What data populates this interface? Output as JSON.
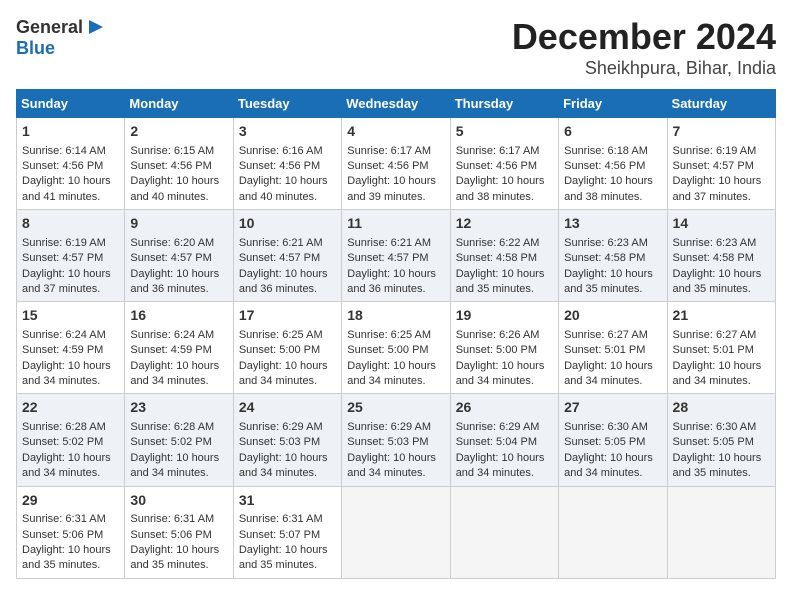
{
  "header": {
    "logo_general": "General",
    "logo_blue": "Blue",
    "title": "December 2024",
    "subtitle": "Sheikhpura, Bihar, India"
  },
  "calendar": {
    "days_of_week": [
      "Sunday",
      "Monday",
      "Tuesday",
      "Wednesday",
      "Thursday",
      "Friday",
      "Saturday"
    ],
    "weeks": [
      [
        {
          "day": "",
          "content": ""
        },
        {
          "day": "",
          "content": ""
        },
        {
          "day": "",
          "content": ""
        },
        {
          "day": "",
          "content": ""
        },
        {
          "day": "",
          "content": ""
        },
        {
          "day": "",
          "content": ""
        },
        {
          "day": "",
          "content": ""
        }
      ]
    ],
    "cells": [
      {
        "day": "1",
        "lines": [
          "Sunrise: 6:14 AM",
          "Sunset: 4:56 PM",
          "Daylight: 10 hours",
          "and 41 minutes."
        ]
      },
      {
        "day": "2",
        "lines": [
          "Sunrise: 6:15 AM",
          "Sunset: 4:56 PM",
          "Daylight: 10 hours",
          "and 40 minutes."
        ]
      },
      {
        "day": "3",
        "lines": [
          "Sunrise: 6:16 AM",
          "Sunset: 4:56 PM",
          "Daylight: 10 hours",
          "and 40 minutes."
        ]
      },
      {
        "day": "4",
        "lines": [
          "Sunrise: 6:17 AM",
          "Sunset: 4:56 PM",
          "Daylight: 10 hours",
          "and 39 minutes."
        ]
      },
      {
        "day": "5",
        "lines": [
          "Sunrise: 6:17 AM",
          "Sunset: 4:56 PM",
          "Daylight: 10 hours",
          "and 38 minutes."
        ]
      },
      {
        "day": "6",
        "lines": [
          "Sunrise: 6:18 AM",
          "Sunset: 4:56 PM",
          "Daylight: 10 hours",
          "and 38 minutes."
        ]
      },
      {
        "day": "7",
        "lines": [
          "Sunrise: 6:19 AM",
          "Sunset: 4:57 PM",
          "Daylight: 10 hours",
          "and 37 minutes."
        ]
      },
      {
        "day": "8",
        "lines": [
          "Sunrise: 6:19 AM",
          "Sunset: 4:57 PM",
          "Daylight: 10 hours",
          "and 37 minutes."
        ]
      },
      {
        "day": "9",
        "lines": [
          "Sunrise: 6:20 AM",
          "Sunset: 4:57 PM",
          "Daylight: 10 hours",
          "and 36 minutes."
        ]
      },
      {
        "day": "10",
        "lines": [
          "Sunrise: 6:21 AM",
          "Sunset: 4:57 PM",
          "Daylight: 10 hours",
          "and 36 minutes."
        ]
      },
      {
        "day": "11",
        "lines": [
          "Sunrise: 6:21 AM",
          "Sunset: 4:57 PM",
          "Daylight: 10 hours",
          "and 36 minutes."
        ]
      },
      {
        "day": "12",
        "lines": [
          "Sunrise: 6:22 AM",
          "Sunset: 4:58 PM",
          "Daylight: 10 hours",
          "and 35 minutes."
        ]
      },
      {
        "day": "13",
        "lines": [
          "Sunrise: 6:23 AM",
          "Sunset: 4:58 PM",
          "Daylight: 10 hours",
          "and 35 minutes."
        ]
      },
      {
        "day": "14",
        "lines": [
          "Sunrise: 6:23 AM",
          "Sunset: 4:58 PM",
          "Daylight: 10 hours",
          "and 35 minutes."
        ]
      },
      {
        "day": "15",
        "lines": [
          "Sunrise: 6:24 AM",
          "Sunset: 4:59 PM",
          "Daylight: 10 hours",
          "and 34 minutes."
        ]
      },
      {
        "day": "16",
        "lines": [
          "Sunrise: 6:24 AM",
          "Sunset: 4:59 PM",
          "Daylight: 10 hours",
          "and 34 minutes."
        ]
      },
      {
        "day": "17",
        "lines": [
          "Sunrise: 6:25 AM",
          "Sunset: 5:00 PM",
          "Daylight: 10 hours",
          "and 34 minutes."
        ]
      },
      {
        "day": "18",
        "lines": [
          "Sunrise: 6:25 AM",
          "Sunset: 5:00 PM",
          "Daylight: 10 hours",
          "and 34 minutes."
        ]
      },
      {
        "day": "19",
        "lines": [
          "Sunrise: 6:26 AM",
          "Sunset: 5:00 PM",
          "Daylight: 10 hours",
          "and 34 minutes."
        ]
      },
      {
        "day": "20",
        "lines": [
          "Sunrise: 6:27 AM",
          "Sunset: 5:01 PM",
          "Daylight: 10 hours",
          "and 34 minutes."
        ]
      },
      {
        "day": "21",
        "lines": [
          "Sunrise: 6:27 AM",
          "Sunset: 5:01 PM",
          "Daylight: 10 hours",
          "and 34 minutes."
        ]
      },
      {
        "day": "22",
        "lines": [
          "Sunrise: 6:28 AM",
          "Sunset: 5:02 PM",
          "Daylight: 10 hours",
          "and 34 minutes."
        ]
      },
      {
        "day": "23",
        "lines": [
          "Sunrise: 6:28 AM",
          "Sunset: 5:02 PM",
          "Daylight: 10 hours",
          "and 34 minutes."
        ]
      },
      {
        "day": "24",
        "lines": [
          "Sunrise: 6:29 AM",
          "Sunset: 5:03 PM",
          "Daylight: 10 hours",
          "and 34 minutes."
        ]
      },
      {
        "day": "25",
        "lines": [
          "Sunrise: 6:29 AM",
          "Sunset: 5:03 PM",
          "Daylight: 10 hours",
          "and 34 minutes."
        ]
      },
      {
        "day": "26",
        "lines": [
          "Sunrise: 6:29 AM",
          "Sunset: 5:04 PM",
          "Daylight: 10 hours",
          "and 34 minutes."
        ]
      },
      {
        "day": "27",
        "lines": [
          "Sunrise: 6:30 AM",
          "Sunset: 5:05 PM",
          "Daylight: 10 hours",
          "and 34 minutes."
        ]
      },
      {
        "day": "28",
        "lines": [
          "Sunrise: 6:30 AM",
          "Sunset: 5:05 PM",
          "Daylight: 10 hours",
          "and 35 minutes."
        ]
      },
      {
        "day": "29",
        "lines": [
          "Sunrise: 6:31 AM",
          "Sunset: 5:06 PM",
          "Daylight: 10 hours",
          "and 35 minutes."
        ]
      },
      {
        "day": "30",
        "lines": [
          "Sunrise: 6:31 AM",
          "Sunset: 5:06 PM",
          "Daylight: 10 hours",
          "and 35 minutes."
        ]
      },
      {
        "day": "31",
        "lines": [
          "Sunrise: 6:31 AM",
          "Sunset: 5:07 PM",
          "Daylight: 10 hours",
          "and 35 minutes."
        ]
      }
    ]
  }
}
